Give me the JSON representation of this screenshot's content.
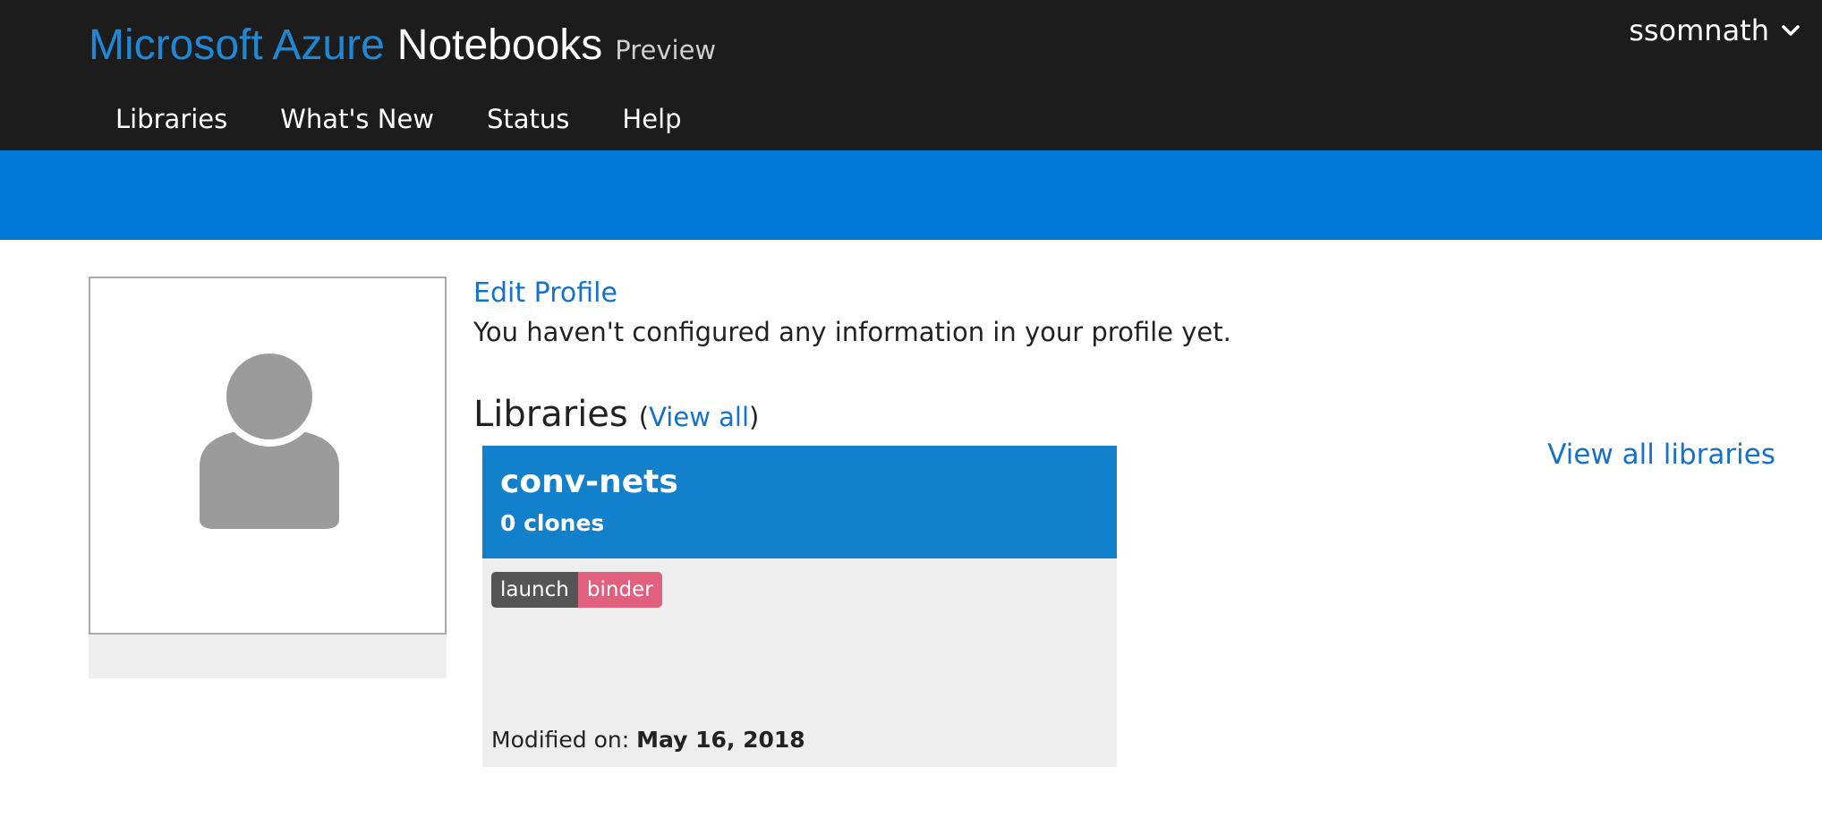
{
  "header": {
    "brand_microsoft_azure": "Microsoft Azure",
    "brand_notebooks": "Notebooks",
    "brand_preview": "Preview",
    "nav": [
      {
        "label": "Libraries"
      },
      {
        "label": "What's New"
      },
      {
        "label": "Status"
      },
      {
        "label": "Help"
      }
    ],
    "user": {
      "name": "ssomnath",
      "icon": "chevron-down-icon"
    }
  },
  "profile": {
    "avatar_icon": "user-avatar-icon",
    "edit_label": "Edit Profile",
    "message": "You haven't configured any information in your profile yet."
  },
  "libraries": {
    "heading": "Libraries",
    "paren_open": "(",
    "view_all_label": "View all",
    "paren_close": ")",
    "view_all_libraries_label": "View all libraries",
    "items": [
      {
        "name": "conv-nets",
        "clones": "0 clones",
        "badge_left": "launch",
        "badge_right": "binder",
        "modified_prefix": "Modified on: ",
        "modified_date": "May 16, 2018"
      }
    ]
  },
  "colors": {
    "top_bar": "#1c1c1c",
    "accent_bar": "#0378d8",
    "brand_blue": "#1e88d6",
    "link": "#1572c9",
    "card_header": "#1380cc",
    "badge_left": "#555555",
    "badge_right": "#e0607e"
  }
}
